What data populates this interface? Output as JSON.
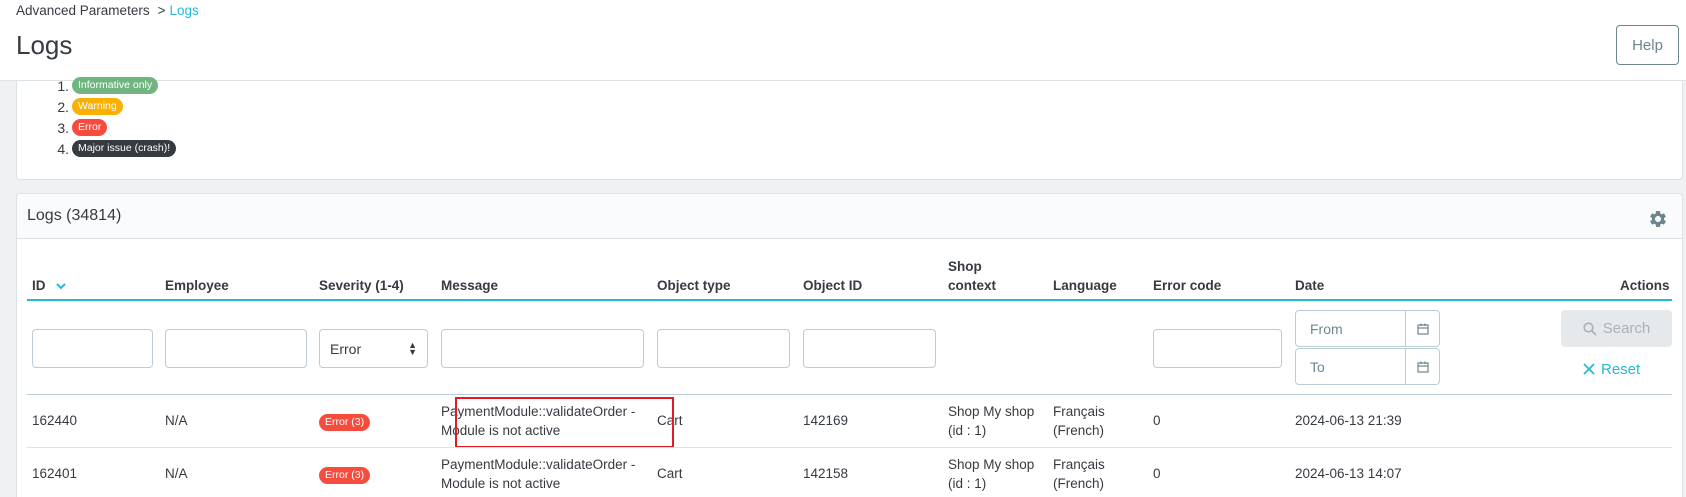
{
  "breadcrumb": {
    "parent": "Advanced Parameters",
    "separator": ">",
    "current": "Logs"
  },
  "page": {
    "title": "Logs",
    "help_label": "Help"
  },
  "severity_levels": [
    {
      "num": "1.",
      "label": "Informative only",
      "color": "#70b580"
    },
    {
      "num": "2.",
      "label": "Warning",
      "color": "#fab000"
    },
    {
      "num": "3.",
      "label": "Error",
      "color": "#f54c3e"
    },
    {
      "num": "4.",
      "label": "Major issue (crash)!",
      "color": "#363a41"
    }
  ],
  "logs": {
    "title": "Logs (34814)",
    "settings_icon": "gear-icon",
    "columns": {
      "id": "ID",
      "employee": "Employee",
      "severity": "Severity (1-4)",
      "message": "Message",
      "object_type": "Object type",
      "object_id": "Object ID",
      "shop_context": "Shop context",
      "language": "Language",
      "error_code": "Error code",
      "date": "Date",
      "actions": "Actions"
    },
    "filters": {
      "severity_selected": "Error",
      "date_from_placeholder": "From",
      "date_to_placeholder": "To",
      "search_label": "Search",
      "reset_label": "Reset"
    },
    "rows": [
      {
        "id": "162440",
        "employee": "N/A",
        "severity": "Error (3)",
        "message_line1": "PaymentModule::validateOrder -",
        "message_line2": "Module is not active",
        "object_type": "Cart",
        "object_id": "142169",
        "shop_line1": "Shop My shop",
        "shop_line2": "(id : 1)",
        "lang_line1": "Français",
        "lang_line2": "(French)",
        "error_code": "0",
        "date": "2024-06-13 21:39"
      },
      {
        "id": "162401",
        "employee": "N/A",
        "severity": "Error (3)",
        "message_line1": "PaymentModule::validateOrder -",
        "message_line2": "Module is not active",
        "object_type": "Cart",
        "object_id": "142158",
        "shop_line1": "Shop My shop",
        "shop_line2": "(id : 1)",
        "lang_line1": "Français",
        "lang_line2": "(French)",
        "error_code": "0",
        "date": "2024-06-13 14:07"
      }
    ]
  },
  "colors": {
    "accent": "#25b9d7",
    "error": "#f54c3e",
    "highlight_box": "#e01b24"
  }
}
